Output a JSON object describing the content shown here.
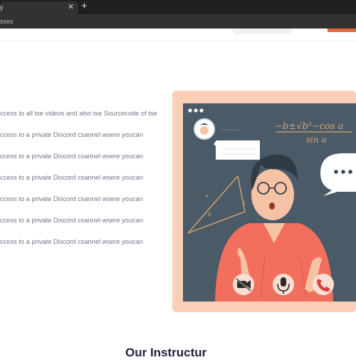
{
  "browser": {
    "tab_title": "y",
    "close_glyph": "✕",
    "new_tab_glyph": "+",
    "address_text": "sses"
  },
  "features": [
    {
      "line1": "ccess to all tse videos and also tse Sourcecode of tse",
      "line2": ""
    },
    {
      "line1": "ccess to a private Discord csannel wsere youcan",
      "line2": ""
    },
    {
      "line1": "ccess to a private Discord csannel wsere youcan",
      "line2": ""
    },
    {
      "line1": "ccess to a private Discord csannel wsere youcan",
      "line2": ""
    },
    {
      "line1": "ccess to a private Discord csannel wsere youcan",
      "line2": ""
    },
    {
      "line1": "ccess to a private Discord csannel wsere youcan",
      "line2": ""
    },
    {
      "line1": "ccess to a private Discord csannel wsere youcan",
      "line2": ""
    }
  ],
  "illustration": {
    "formula_main": "−b±√b²−cos a",
    "formula_denominator": "sin a",
    "triangle_labels": [
      "+",
      "x",
      "y"
    ],
    "call_controls": [
      "camera-off-icon",
      "microphone-icon",
      "phone-hangup-icon"
    ]
  },
  "section": {
    "title": "Our Instructur"
  },
  "colors": {
    "frame": "#f9cfb7",
    "board": "#4a5a67",
    "shirt": "#f26f5e",
    "hangup": "#e03a3a",
    "heading": "#1d2140",
    "body_text": "#6d7686"
  }
}
